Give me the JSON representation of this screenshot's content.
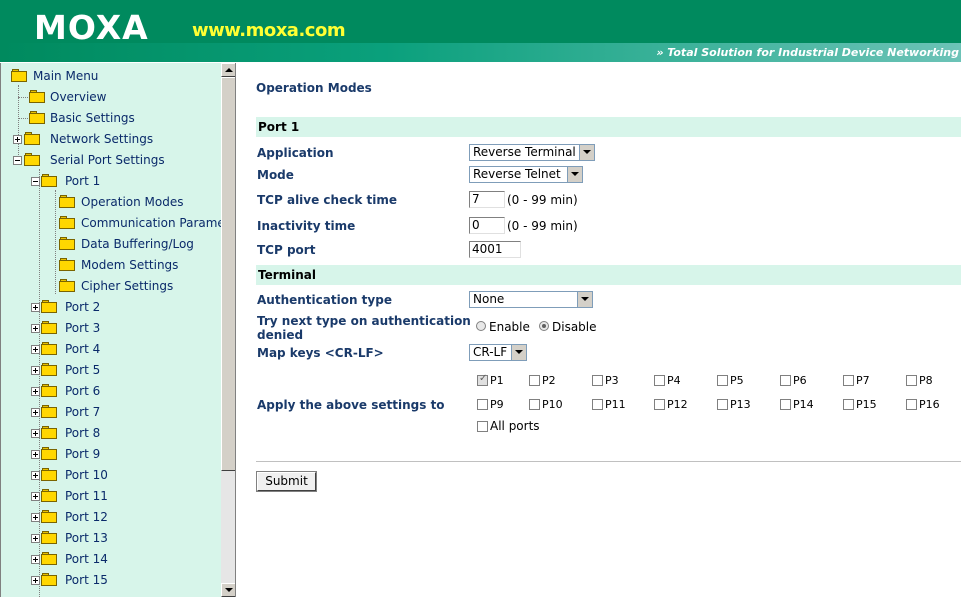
{
  "header": {
    "logo": "MOXA",
    "url": "www.moxa.com",
    "tagline": "» Total Solution for Industrial Device Networking"
  },
  "sidebar": {
    "items": [
      {
        "label": "Main Menu"
      },
      {
        "label": "Overview"
      },
      {
        "label": "Basic Settings"
      },
      {
        "label": "Network Settings"
      },
      {
        "label": "Serial Port Settings"
      },
      {
        "label": "Port 1"
      },
      {
        "label": "Operation Modes"
      },
      {
        "label": "Communication Parameters"
      },
      {
        "label": "Data Buffering/Log"
      },
      {
        "label": "Modem Settings"
      },
      {
        "label": "Cipher Settings"
      },
      {
        "label": "Port 2"
      },
      {
        "label": "Port 3"
      },
      {
        "label": "Port 4"
      },
      {
        "label": "Port 5"
      },
      {
        "label": "Port 6"
      },
      {
        "label": "Port 7"
      },
      {
        "label": "Port 8"
      },
      {
        "label": "Port 9"
      },
      {
        "label": "Port 10"
      },
      {
        "label": "Port 11"
      },
      {
        "label": "Port 12"
      },
      {
        "label": "Port 13"
      },
      {
        "label": "Port 14"
      },
      {
        "label": "Port 15"
      }
    ]
  },
  "main": {
    "title": "Operation Modes",
    "port_section": "Port 1",
    "application": {
      "label": "Application",
      "value": "Reverse Terminal"
    },
    "mode": {
      "label": "Mode",
      "value": "Reverse Telnet"
    },
    "tcp_alive": {
      "label": "TCP alive check time",
      "value": "7",
      "hint": "(0 - 99 min)"
    },
    "inactivity": {
      "label": "Inactivity time",
      "value": "0",
      "hint": "(0 - 99 min)"
    },
    "tcp_port": {
      "label": "TCP port",
      "value": "4001"
    },
    "terminal_section": "Terminal",
    "auth_type": {
      "label": "Authentication type",
      "value": "None"
    },
    "try_next": {
      "label_line1": "Try next type on authentication",
      "label_line2": "denied",
      "enable": "Enable",
      "disable": "Disable",
      "selected": "Disable"
    },
    "map_keys": {
      "label": "Map keys <CR-LF>",
      "value": "CR-LF"
    },
    "apply": {
      "label": "Apply the above settings to",
      "ports": [
        "P1",
        "P2",
        "P3",
        "P4",
        "P5",
        "P6",
        "P7",
        "P8",
        "P9",
        "P10",
        "P11",
        "P12",
        "P13",
        "P14",
        "P15",
        "P16"
      ],
      "checked": [
        "P1"
      ],
      "all_ports": "All ports"
    },
    "submit": "Submit"
  }
}
